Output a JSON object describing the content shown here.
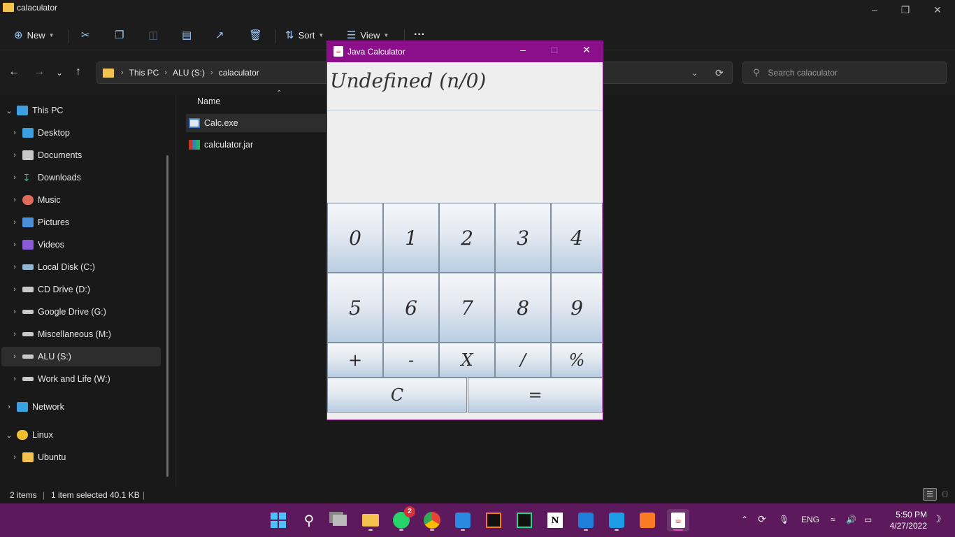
{
  "explorer": {
    "title": "calaculator",
    "toolbar": {
      "new_label": "New",
      "sort_label": "Sort",
      "view_label": "View",
      "more_label": "···"
    },
    "breadcrumb": [
      "This PC",
      "ALU (S:)",
      "calaculator"
    ],
    "search_placeholder": "Search calaculator",
    "sidebar": [
      {
        "label": "This PC",
        "icon": "pc-icon",
        "expanded": true
      },
      {
        "label": "Desktop",
        "icon": "desktop-icon"
      },
      {
        "label": "Documents",
        "icon": "documents-icon"
      },
      {
        "label": "Downloads",
        "icon": "downloads-icon"
      },
      {
        "label": "Music",
        "icon": "music-icon"
      },
      {
        "label": "Pictures",
        "icon": "pictures-icon"
      },
      {
        "label": "Videos",
        "icon": "videos-icon"
      },
      {
        "label": "Local Disk (C:)",
        "icon": "drive-icon"
      },
      {
        "label": "CD Drive (D:)",
        "icon": "cd-drive-icon"
      },
      {
        "label": "Google Drive (G:)",
        "icon": "drive-icon"
      },
      {
        "label": "Miscellaneous (M:)",
        "icon": "drive-icon"
      },
      {
        "label": "ALU (S:)",
        "icon": "drive-icon",
        "selected": true
      },
      {
        "label": "Work and Life (W:)",
        "icon": "drive-icon"
      },
      {
        "label": "Network",
        "icon": "network-icon"
      },
      {
        "label": "Linux",
        "icon": "linux-icon",
        "expanded": true
      },
      {
        "label": "Ubuntu",
        "icon": "folder-icon"
      }
    ],
    "column_name": "Name",
    "files": [
      {
        "name": "Calc.exe",
        "icon": "exe-icon",
        "selected": true
      },
      {
        "name": "calculator.jar",
        "icon": "jar-icon"
      }
    ],
    "status": {
      "items": "2 items",
      "selected": "1 item selected",
      "size": "40.1 KB"
    }
  },
  "calculator": {
    "title": "Java Calculator",
    "display": "Undefined (n/0)",
    "digits_row1": [
      "0",
      "1",
      "2",
      "3",
      "4"
    ],
    "digits_row2": [
      "5",
      "6",
      "7",
      "8",
      "9"
    ],
    "operators": [
      "+",
      "-",
      "X",
      "/",
      "%"
    ],
    "clear_label": "C",
    "equals_label": "="
  },
  "taskbar": {
    "apps": [
      {
        "name": "start-icon"
      },
      {
        "name": "search-icon"
      },
      {
        "name": "task-view-icon"
      },
      {
        "name": "file-explorer-icon"
      },
      {
        "name": "whatsapp-icon",
        "badge": "2"
      },
      {
        "name": "chrome-icon"
      },
      {
        "name": "vscode-icon"
      },
      {
        "name": "intellij-icon"
      },
      {
        "name": "pycharm-icon"
      },
      {
        "name": "notion-icon"
      },
      {
        "name": "media-player-icon"
      },
      {
        "name": "send-icon"
      },
      {
        "name": "xampp-icon"
      },
      {
        "name": "java-icon",
        "active": true
      }
    ],
    "language": "ENG",
    "time": "5:50 PM",
    "date": "4/27/2022"
  }
}
